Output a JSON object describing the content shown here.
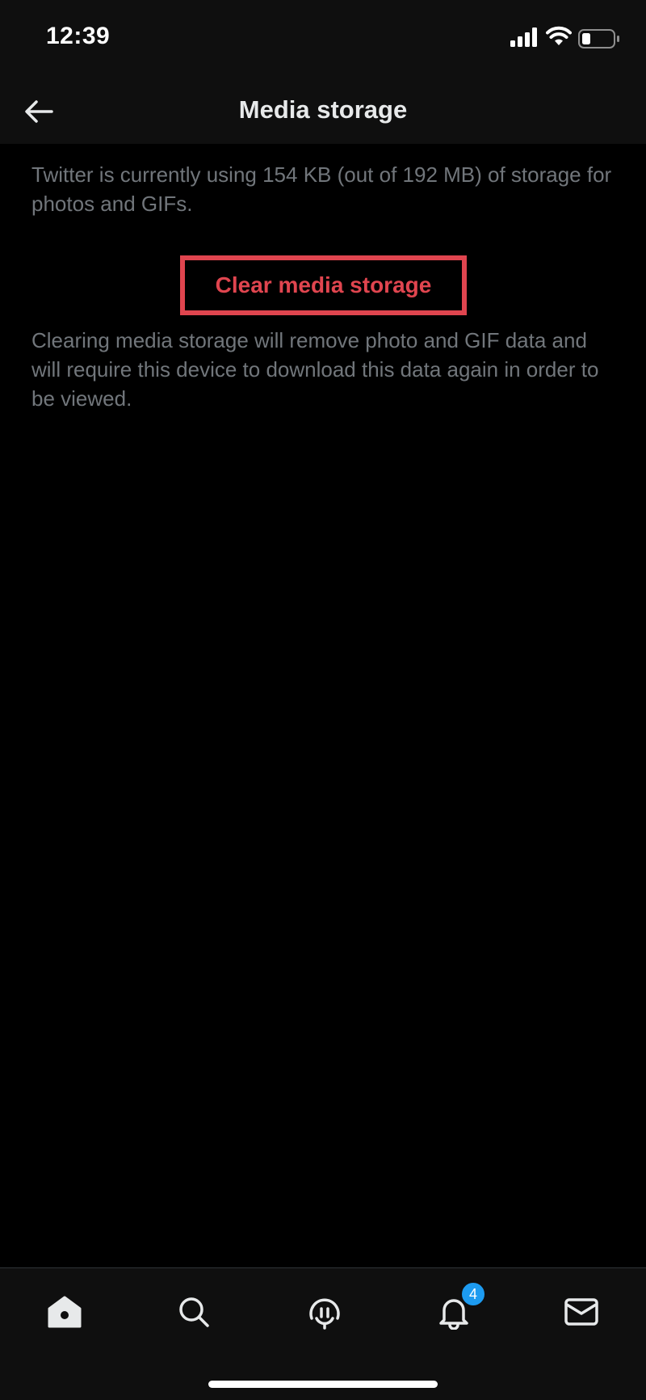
{
  "status_bar": {
    "time": "12:39"
  },
  "header": {
    "title": "Media storage",
    "back_icon": "arrow-left-icon"
  },
  "content": {
    "usage_text": "Twitter is currently using 154 KB (out of 192 MB) of storage for photos and GIFs.",
    "clear_button_label": "Clear media storage",
    "clear_note": "Clearing media storage will remove photo and GIF data and will require this device to download this data again in order to be viewed."
  },
  "bottom_nav": {
    "items": [
      {
        "icon": "home-icon"
      },
      {
        "icon": "search-icon"
      },
      {
        "icon": "spaces-icon"
      },
      {
        "icon": "bell-icon",
        "badge": "4"
      },
      {
        "icon": "mail-icon"
      }
    ]
  },
  "colors": {
    "background": "#000000",
    "bar_background": "#0f0f0f",
    "primary_text": "#e7e9ea",
    "secondary_text": "#71767b",
    "destructive": "#e0454f",
    "accent": "#1d9bf0"
  }
}
